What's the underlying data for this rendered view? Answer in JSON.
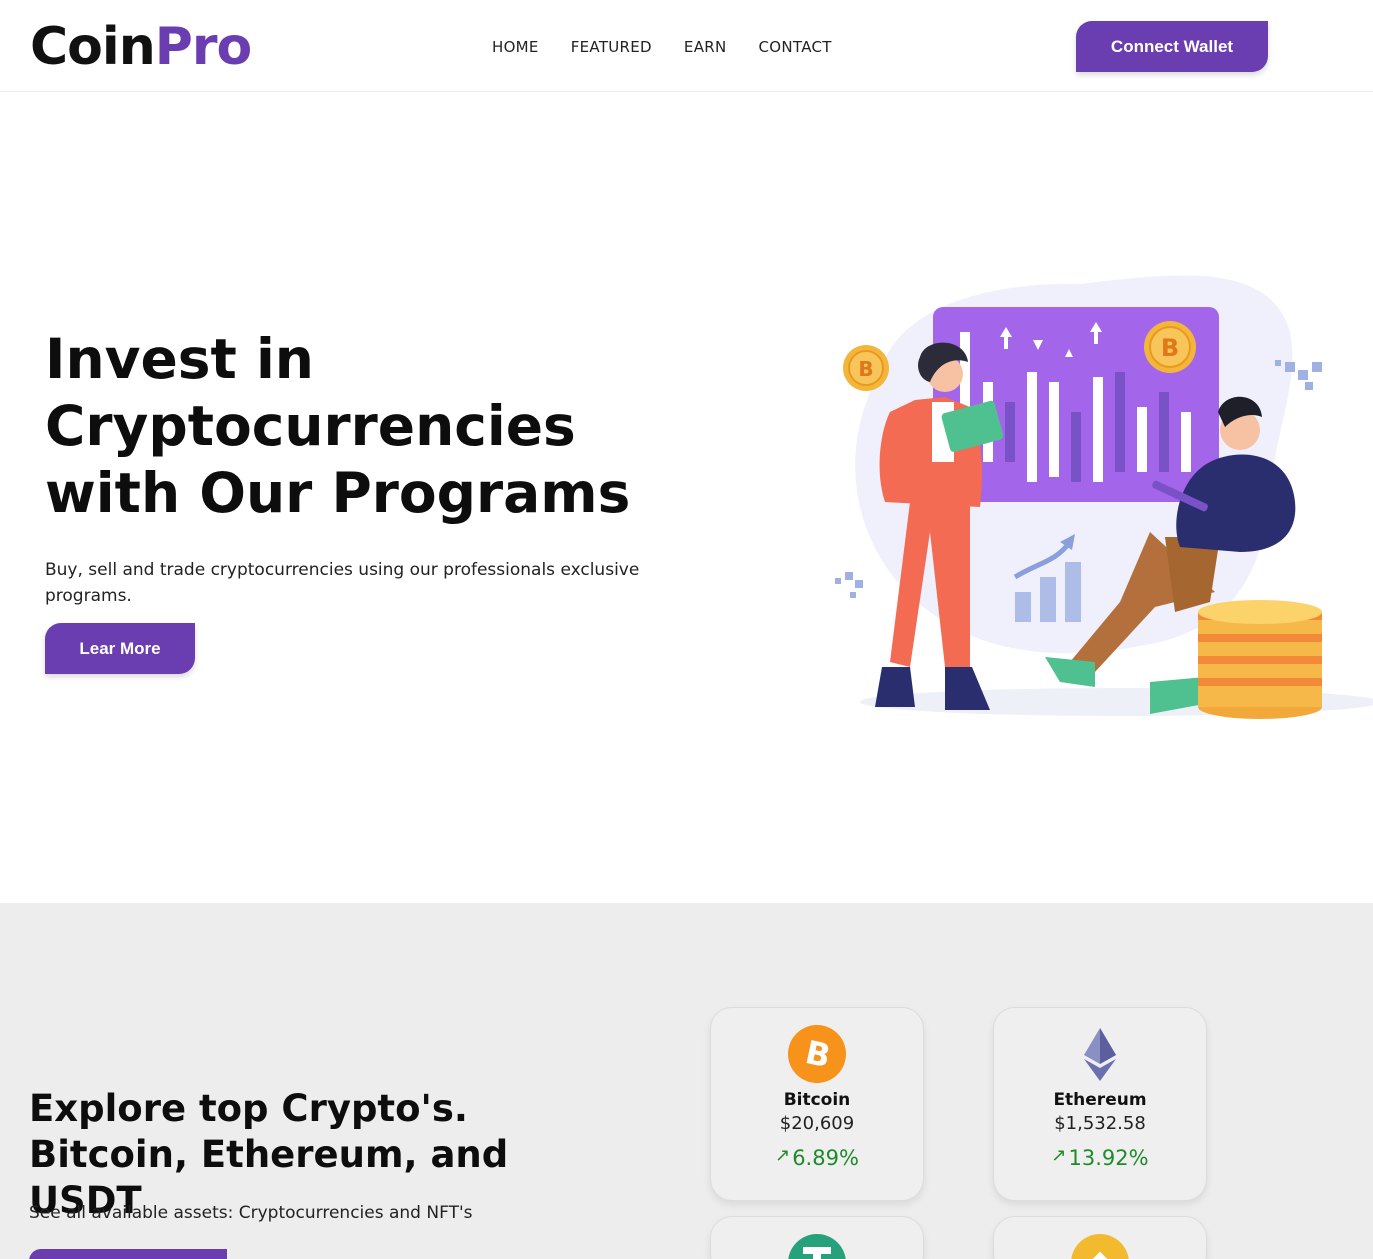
{
  "header": {
    "logo_part1": "Coin",
    "logo_part2": "Pro",
    "nav": [
      "HOME",
      "FEATURED",
      "EARN",
      "CONTACT"
    ],
    "connect_label": "Connect Wallet"
  },
  "hero": {
    "title": "Invest in Cryptocurrencies with Our Programs",
    "subtitle": "Buy, sell and trade cryptocurrencies using our professionals exclusive programs.",
    "button_label": "Lear More"
  },
  "explore": {
    "title": "Explore top Crypto's. Bitcoin, Ethereum, and USDT",
    "subtitle": "See all available assets: Cryptocurrencies and NFT's",
    "coins": [
      {
        "name": "Bitcoin",
        "price": "$20,609",
        "change": "6.89%",
        "icon": "bitcoin-icon"
      },
      {
        "name": "Ethereum",
        "price": "$1,532.58",
        "change": "13.92%",
        "icon": "ethereum-icon"
      }
    ]
  },
  "colors": {
    "accent": "#6a3eb0",
    "positive": "#1f8a2b",
    "section_bg": "#ededed"
  }
}
